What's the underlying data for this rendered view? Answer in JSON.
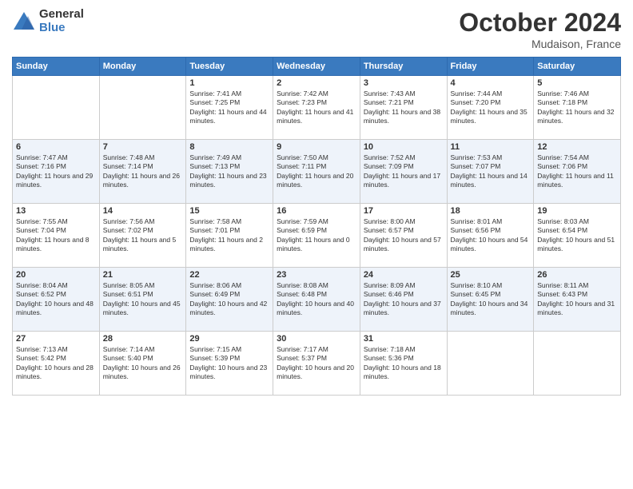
{
  "header": {
    "logo_general": "General",
    "logo_blue": "Blue",
    "month": "October 2024",
    "location": "Mudaison, France"
  },
  "days_of_week": [
    "Sunday",
    "Monday",
    "Tuesday",
    "Wednesday",
    "Thursday",
    "Friday",
    "Saturday"
  ],
  "weeks": [
    [
      {
        "day": "",
        "content": ""
      },
      {
        "day": "",
        "content": ""
      },
      {
        "day": "1",
        "content": "Sunrise: 7:41 AM\nSunset: 7:25 PM\nDaylight: 11 hours and 44 minutes."
      },
      {
        "day": "2",
        "content": "Sunrise: 7:42 AM\nSunset: 7:23 PM\nDaylight: 11 hours and 41 minutes."
      },
      {
        "day": "3",
        "content": "Sunrise: 7:43 AM\nSunset: 7:21 PM\nDaylight: 11 hours and 38 minutes."
      },
      {
        "day": "4",
        "content": "Sunrise: 7:44 AM\nSunset: 7:20 PM\nDaylight: 11 hours and 35 minutes."
      },
      {
        "day": "5",
        "content": "Sunrise: 7:46 AM\nSunset: 7:18 PM\nDaylight: 11 hours and 32 minutes."
      }
    ],
    [
      {
        "day": "6",
        "content": "Sunrise: 7:47 AM\nSunset: 7:16 PM\nDaylight: 11 hours and 29 minutes."
      },
      {
        "day": "7",
        "content": "Sunrise: 7:48 AM\nSunset: 7:14 PM\nDaylight: 11 hours and 26 minutes."
      },
      {
        "day": "8",
        "content": "Sunrise: 7:49 AM\nSunset: 7:13 PM\nDaylight: 11 hours and 23 minutes."
      },
      {
        "day": "9",
        "content": "Sunrise: 7:50 AM\nSunset: 7:11 PM\nDaylight: 11 hours and 20 minutes."
      },
      {
        "day": "10",
        "content": "Sunrise: 7:52 AM\nSunset: 7:09 PM\nDaylight: 11 hours and 17 minutes."
      },
      {
        "day": "11",
        "content": "Sunrise: 7:53 AM\nSunset: 7:07 PM\nDaylight: 11 hours and 14 minutes."
      },
      {
        "day": "12",
        "content": "Sunrise: 7:54 AM\nSunset: 7:06 PM\nDaylight: 11 hours and 11 minutes."
      }
    ],
    [
      {
        "day": "13",
        "content": "Sunrise: 7:55 AM\nSunset: 7:04 PM\nDaylight: 11 hours and 8 minutes."
      },
      {
        "day": "14",
        "content": "Sunrise: 7:56 AM\nSunset: 7:02 PM\nDaylight: 11 hours and 5 minutes."
      },
      {
        "day": "15",
        "content": "Sunrise: 7:58 AM\nSunset: 7:01 PM\nDaylight: 11 hours and 2 minutes."
      },
      {
        "day": "16",
        "content": "Sunrise: 7:59 AM\nSunset: 6:59 PM\nDaylight: 11 hours and 0 minutes."
      },
      {
        "day": "17",
        "content": "Sunrise: 8:00 AM\nSunset: 6:57 PM\nDaylight: 10 hours and 57 minutes."
      },
      {
        "day": "18",
        "content": "Sunrise: 8:01 AM\nSunset: 6:56 PM\nDaylight: 10 hours and 54 minutes."
      },
      {
        "day": "19",
        "content": "Sunrise: 8:03 AM\nSunset: 6:54 PM\nDaylight: 10 hours and 51 minutes."
      }
    ],
    [
      {
        "day": "20",
        "content": "Sunrise: 8:04 AM\nSunset: 6:52 PM\nDaylight: 10 hours and 48 minutes."
      },
      {
        "day": "21",
        "content": "Sunrise: 8:05 AM\nSunset: 6:51 PM\nDaylight: 10 hours and 45 minutes."
      },
      {
        "day": "22",
        "content": "Sunrise: 8:06 AM\nSunset: 6:49 PM\nDaylight: 10 hours and 42 minutes."
      },
      {
        "day": "23",
        "content": "Sunrise: 8:08 AM\nSunset: 6:48 PM\nDaylight: 10 hours and 40 minutes."
      },
      {
        "day": "24",
        "content": "Sunrise: 8:09 AM\nSunset: 6:46 PM\nDaylight: 10 hours and 37 minutes."
      },
      {
        "day": "25",
        "content": "Sunrise: 8:10 AM\nSunset: 6:45 PM\nDaylight: 10 hours and 34 minutes."
      },
      {
        "day": "26",
        "content": "Sunrise: 8:11 AM\nSunset: 6:43 PM\nDaylight: 10 hours and 31 minutes."
      }
    ],
    [
      {
        "day": "27",
        "content": "Sunrise: 7:13 AM\nSunset: 5:42 PM\nDaylight: 10 hours and 28 minutes."
      },
      {
        "day": "28",
        "content": "Sunrise: 7:14 AM\nSunset: 5:40 PM\nDaylight: 10 hours and 26 minutes."
      },
      {
        "day": "29",
        "content": "Sunrise: 7:15 AM\nSunset: 5:39 PM\nDaylight: 10 hours and 23 minutes."
      },
      {
        "day": "30",
        "content": "Sunrise: 7:17 AM\nSunset: 5:37 PM\nDaylight: 10 hours and 20 minutes."
      },
      {
        "day": "31",
        "content": "Sunrise: 7:18 AM\nSunset: 5:36 PM\nDaylight: 10 hours and 18 minutes."
      },
      {
        "day": "",
        "content": ""
      },
      {
        "day": "",
        "content": ""
      }
    ]
  ]
}
